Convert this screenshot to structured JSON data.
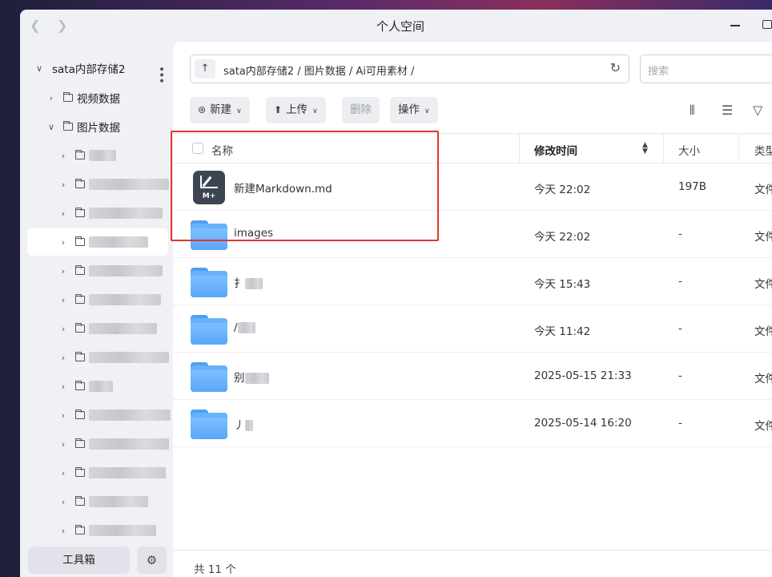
{
  "window": {
    "title": "个人空间"
  },
  "sidebar": {
    "root": "sata内部存储2",
    "video_folder": "视频数据",
    "image_folder": "图片数据",
    "subfolders": [
      "",
      "",
      "",
      "",
      "",
      "",
      "",
      "",
      "",
      "",
      "",
      "",
      "",
      ""
    ],
    "toolbox_label": "工具箱"
  },
  "pathbar": {
    "path": "sata内部存储2 / 图片数据 / Ai可用素材 /"
  },
  "search": {
    "placeholder": "搜索"
  },
  "toolbar": {
    "new": "新建",
    "upload": "上传",
    "delete": "删除",
    "actions": "操作"
  },
  "table": {
    "columns": {
      "name": "名称",
      "mtime": "修改时间",
      "size": "大小",
      "kind": "类型"
    },
    "rows": [
      {
        "name": "新建Markdown.md",
        "mtime": "今天 22:02",
        "size": "197B",
        "kind": "文件",
        "icon": "markdown-icon"
      },
      {
        "name": "images",
        "mtime": "今天 22:02",
        "size": "-",
        "kind": "文件",
        "icon": "folder-icon"
      },
      {
        "name": "扌",
        "mtime": "今天 15:43",
        "size": "-",
        "kind": "文件",
        "icon": "folder-icon"
      },
      {
        "name": "/",
        "mtime": "今天 11:42",
        "size": "-",
        "kind": "文件",
        "icon": "folder-icon"
      },
      {
        "name": "别",
        "mtime": "2025-05-15 21:33",
        "size": "-",
        "kind": "文件",
        "icon": "folder-icon"
      },
      {
        "name": "丿",
        "mtime": "2025-05-14 16:20",
        "size": "-",
        "kind": "文件",
        "icon": "folder-icon"
      }
    ]
  },
  "footer": {
    "count": "共 11 个"
  },
  "colors": {
    "highlight": "#e0362d",
    "folder": "#67b2fb",
    "panel": "#f0f1f5"
  }
}
